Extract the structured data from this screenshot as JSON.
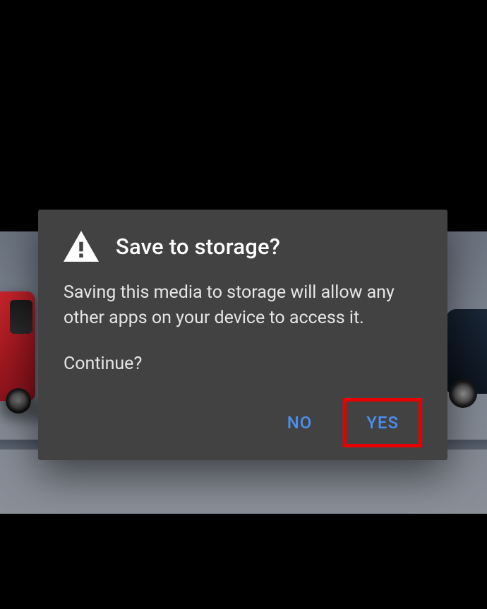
{
  "dialog": {
    "title": "Save to storage?",
    "body_line1": "Saving this media to storage will allow any other apps on your device to access it.",
    "body_line2": "Continue?",
    "no_label": "NO",
    "yes_label": "YES"
  }
}
